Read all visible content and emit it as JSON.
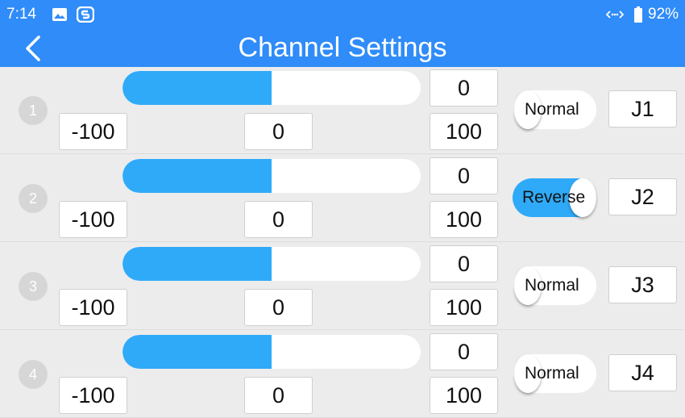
{
  "status_bar": {
    "time": "7:14",
    "battery": "92%",
    "icons": [
      "image-icon",
      "s-app-icon",
      "data-transfer-icon",
      "battery-icon"
    ]
  },
  "header": {
    "title": "Channel Settings",
    "back_icon": "chevron-left-icon"
  },
  "channels": [
    {
      "number": "1",
      "value": "0",
      "min": "-100",
      "center": "0",
      "max": "100",
      "fill_fraction": 0.5,
      "mode": "Normal",
      "reversed": false,
      "assign": "J1"
    },
    {
      "number": "2",
      "value": "0",
      "min": "-100",
      "center": "0",
      "max": "100",
      "fill_fraction": 0.5,
      "mode": "Reverse",
      "reversed": true,
      "assign": "J2"
    },
    {
      "number": "3",
      "value": "0",
      "min": "-100",
      "center": "0",
      "max": "100",
      "fill_fraction": 0.5,
      "mode": "Normal",
      "reversed": false,
      "assign": "J3"
    },
    {
      "number": "4",
      "value": "0",
      "min": "-100",
      "center": "0",
      "max": "100",
      "fill_fraction": 0.5,
      "mode": "Normal",
      "reversed": false,
      "assign": "J4"
    }
  ],
  "colors": {
    "header_blue": "#2f8cf8",
    "bar_blue": "#2faaf8",
    "background": "#ececec"
  }
}
